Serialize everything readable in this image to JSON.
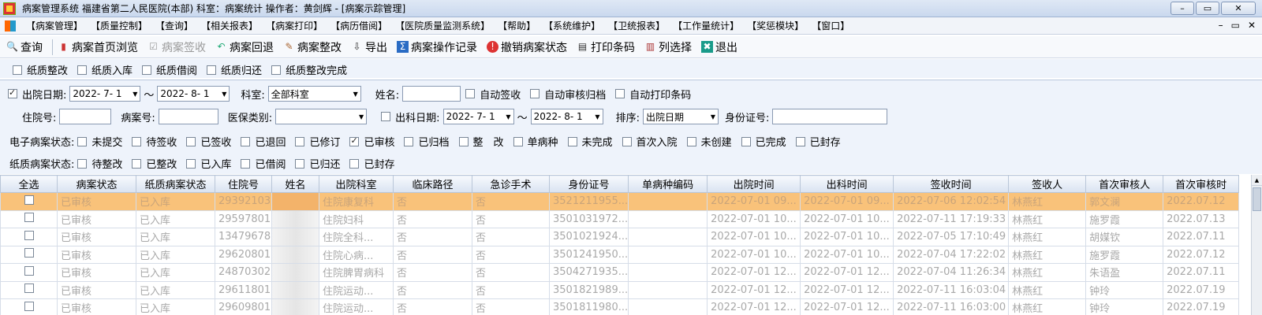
{
  "window": {
    "title": "病案管理系统  福建省第二人民医院(本部)  科室：病案统计 操作者：黄剑辉 - [病案示踪管理]",
    "buttons": [
      "–",
      "▭",
      "✕"
    ]
  },
  "menu": {
    "items": [
      "【病案管理】",
      "【质量控制】",
      "【查询】",
      "【相关报表】",
      "【病案打印】",
      "【病历借阅】",
      "【医院质量监测系统】",
      "【帮助】",
      "【系统维护】",
      "【卫统报表】",
      "【工作量统计】",
      "【奖惩模块】",
      "【窗口】"
    ],
    "mdi_buttons": [
      "–",
      "▭",
      "✕"
    ]
  },
  "toolbar": {
    "items": [
      {
        "label": "查询",
        "icon": "magnifier-icon",
        "disabled": false
      },
      {
        "label": "病案首页浏览",
        "icon": "page-icon",
        "disabled": false
      },
      {
        "label": "病案签收",
        "icon": "check-stamp-icon",
        "disabled": true
      },
      {
        "label": "病案回退",
        "icon": "return-icon",
        "disabled": false
      },
      {
        "label": "病案整改",
        "icon": "edit-icon",
        "disabled": false
      },
      {
        "label": "导出",
        "icon": "export-icon",
        "disabled": false
      },
      {
        "label": "病案操作记录",
        "icon": "sigma-icon",
        "disabled": false
      },
      {
        "label": "撤销病案状态",
        "icon": "warning-icon",
        "disabled": false
      },
      {
        "label": "打印条码",
        "icon": "printer-icon",
        "disabled": false
      },
      {
        "label": "列选择",
        "icon": "columns-icon",
        "disabled": false
      },
      {
        "label": "退出",
        "icon": "exit-icon",
        "disabled": false
      }
    ]
  },
  "paper_actions": [
    "纸质整改",
    "纸质入库",
    "纸质借阅",
    "纸质归还",
    "纸质整改完成"
  ],
  "filters": {
    "discharge_date_label": "出院日期:",
    "discharge_date_checked": true,
    "discharge_from": "2022- 7- 1",
    "discharge_to": "2022- 8- 1",
    "tilde": "～",
    "dept_label": "科室:",
    "dept_value": "全部科室",
    "name_label": "姓名:",
    "name_value": "",
    "auto_sign": "自动签收",
    "auto_review": "自动审核归档",
    "auto_print": "自动打印条码",
    "inpatient_no_label": "住院号:",
    "record_no_label": "病案号:",
    "insurance_label": "医保类别:",
    "insurance_value": "",
    "out_dept_date_label": "出科日期:",
    "out_dept_from": "2022- 7- 1",
    "out_dept_to": "2022- 8- 1",
    "sort_label": "排序:",
    "sort_value": "出院日期",
    "id_label": "身份证号:"
  },
  "e_status": {
    "label": "电子病案状态:",
    "options": [
      {
        "label": "未提交",
        "checked": false
      },
      {
        "label": "待签收",
        "checked": false
      },
      {
        "label": "已签收",
        "checked": false
      },
      {
        "label": "已退回",
        "checked": false
      },
      {
        "label": "已修订",
        "checked": false
      },
      {
        "label": "已审核",
        "checked": true
      },
      {
        "label": "已归档",
        "checked": false
      },
      {
        "label": "整　改",
        "checked": false
      },
      {
        "label": "单病种",
        "checked": false
      },
      {
        "label": "未完成",
        "checked": false
      },
      {
        "label": "首次入院",
        "checked": false
      },
      {
        "label": "未创建",
        "checked": false
      },
      {
        "label": "已完成",
        "checked": false
      },
      {
        "label": "已封存",
        "checked": false
      }
    ]
  },
  "p_status": {
    "label": "纸质病案状态:",
    "options": [
      {
        "label": "待整改",
        "checked": false
      },
      {
        "label": "已整改",
        "checked": false
      },
      {
        "label": "已入库",
        "checked": false
      },
      {
        "label": "已借阅",
        "checked": false
      },
      {
        "label": "已归还",
        "checked": false
      },
      {
        "label": "已封存",
        "checked": false
      }
    ]
  },
  "table": {
    "headers": [
      "全选",
      "病案状态",
      "纸质病案状态",
      "住院号",
      "姓名",
      "出院科室",
      "临床路径",
      "急诊手术",
      "身份证号",
      "单病种编码",
      "出院时间",
      "出科时间",
      "签收时间",
      "签收人",
      "首次审核人",
      "首次审核时"
    ],
    "rows": [
      [
        "",
        "已审核",
        "已入库",
        "29392103",
        "",
        "住院康复科",
        "否",
        "否",
        "3521211955...",
        "",
        "2022-07-01 09...",
        "2022-07-01 09...",
        "2022-07-06 12:02:54",
        "林燕红",
        "郭文澜",
        "2022.07.12"
      ],
      [
        "",
        "已审核",
        "已入库",
        "29597801",
        "",
        "住院妇科",
        "否",
        "否",
        "3501031972...",
        "",
        "2022-07-01 10...",
        "2022-07-01 10...",
        "2022-07-11 17:19:33",
        "林燕红",
        "施罗霞",
        "2022.07.13"
      ],
      [
        "",
        "已审核",
        "已入库",
        "13479678",
        "",
        "住院全科...",
        "否",
        "否",
        "3501021924...",
        "",
        "2022-07-01 10...",
        "2022-07-01 10...",
        "2022-07-05 17:10:49",
        "林燕红",
        "胡媒钦",
        "2022.07.11"
      ],
      [
        "",
        "已审核",
        "已入库",
        "29620801",
        "",
        "住院心病...",
        "否",
        "否",
        "3501241950...",
        "",
        "2022-07-01 10...",
        "2022-07-01 10...",
        "2022-07-04 17:22:02",
        "林燕红",
        "施罗霞",
        "2022.07.12"
      ],
      [
        "",
        "已审核",
        "已入库",
        "24870302",
        "",
        "住院脾胃病科",
        "否",
        "否",
        "3504271935...",
        "",
        "2022-07-01 12...",
        "2022-07-01 12...",
        "2022-07-04 11:26:34",
        "林燕红",
        "朱语盈",
        "2022.07.11"
      ],
      [
        "",
        "已审核",
        "已入库",
        "29611801",
        "",
        "住院运动...",
        "否",
        "否",
        "3501821989...",
        "",
        "2022-07-01 12...",
        "2022-07-01 12...",
        "2022-07-11 16:03:04",
        "林燕红",
        "钟玲",
        "2022.07.19"
      ],
      [
        "",
        "已审核",
        "已入库",
        "29609801",
        "",
        "住院运动...",
        "否",
        "否",
        "3501811980...",
        "",
        "2022-07-01 12...",
        "2022-07-01 12...",
        "2022-07-11 16:03:00",
        "林燕红",
        "钟玲",
        "2022.07.19"
      ]
    ]
  },
  "colors": {
    "selected_row": "#f9c27a",
    "panel_bg": "#eef3fb",
    "title_bg": "#c9d8ee"
  }
}
